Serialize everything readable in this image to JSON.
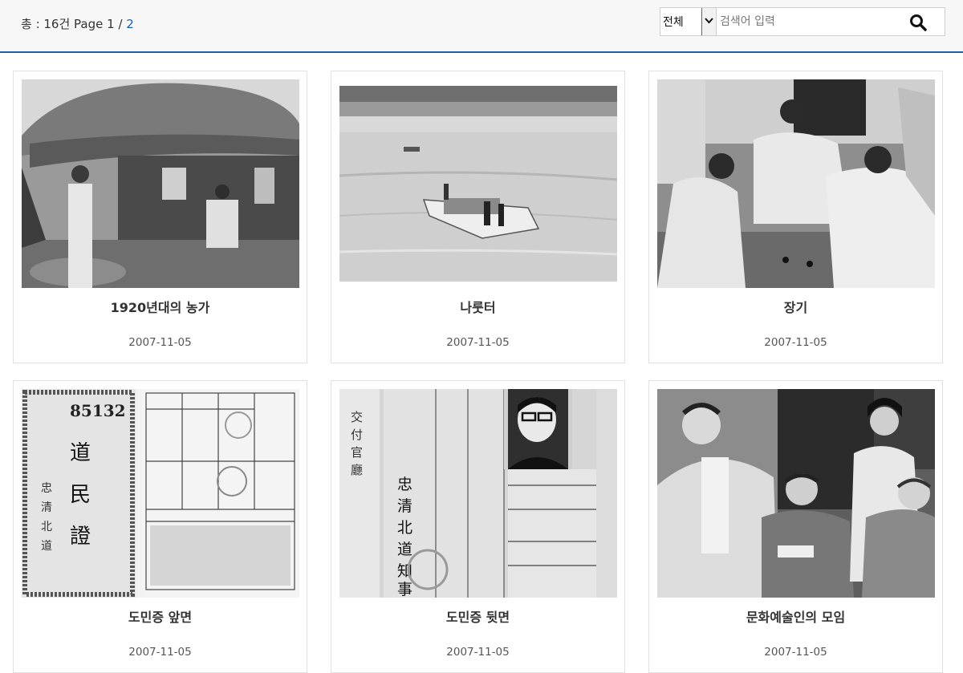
{
  "header": {
    "count_prefix": "총 : 16건 Page 1 / ",
    "page_link": "2",
    "search": {
      "select_value": "전체",
      "placeholder": "검색어 입력",
      "button_icon": "search-icon"
    }
  },
  "cards": [
    {
      "title": "1920년대의 농가",
      "date": "2007-11-05"
    },
    {
      "title": "나룻터",
      "date": "2007-11-05"
    },
    {
      "title": "장기",
      "date": "2007-11-05"
    },
    {
      "title": "도민증 앞면",
      "date": "2007-11-05"
    },
    {
      "title": "도민증 뒷면",
      "date": "2007-11-05"
    },
    {
      "title": "문화예술인의 모임",
      "date": "2007-11-05"
    }
  ],
  "images": {
    "idcard_front": {
      "number": "85132",
      "vertical_text": [
        "道",
        "民",
        "證"
      ],
      "side_text": [
        "忠",
        "清",
        "北",
        "道"
      ]
    },
    "idcard_back": {
      "vertical_text": [
        "忠",
        "清",
        "北",
        "道",
        "知",
        "事"
      ],
      "stamp_text": [
        "交",
        "付",
        "官",
        "廳"
      ]
    }
  },
  "colors": {
    "accent": "#1f5fa5",
    "topbar_bg": "#f7f7f7"
  }
}
